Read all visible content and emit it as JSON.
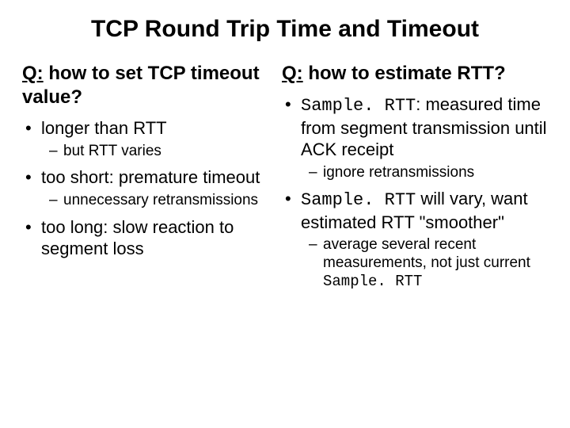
{
  "title": "TCP Round Trip Time and Timeout",
  "left": {
    "q_label": "Q:",
    "q_text": " how to set TCP timeout value?",
    "b1": "longer than RTT",
    "b1_sub1": "but RTT varies",
    "b2": "too short: premature timeout",
    "b2_sub1": "unnecessary retransmissions",
    "b3": "too long: slow reaction to segment loss"
  },
  "right": {
    "q_label": "Q:",
    "q_text": " how to estimate RTT?",
    "b1_code": "Sample. RTT",
    "b1_rest": ": measured time from segment transmission until ACK receipt",
    "b1_sub1": "ignore retransmissions",
    "b2_code": "Sample. RTT",
    "b2_rest": " will vary, want estimated RTT \"smoother\"",
    "b2_sub1_pre": "average several recent measurements, not just current ",
    "b2_sub1_code": "Sample. RTT"
  }
}
